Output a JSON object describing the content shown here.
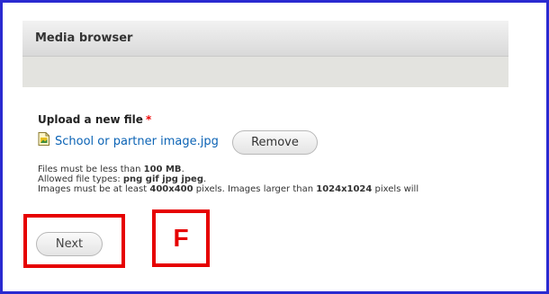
{
  "dialog": {
    "title": "Media browser"
  },
  "upload": {
    "label": "Upload a new file",
    "required_mark": "*",
    "file_name": "School or partner image.jpg",
    "file_icon": "image-file-icon",
    "remove_label": "Remove",
    "help_size_prefix": "Files must be less than ",
    "help_size_value": "100 MB",
    "help_size_suffix": ".",
    "help_types_prefix": "Allowed file types: ",
    "help_types_value": "png gif jpg jpeg",
    "help_types_suffix": ".",
    "help_dims_prefix": "Images must be at least ",
    "help_dims_min": "400x400",
    "help_dims_mid": " pixels. Images larger than ",
    "help_dims_max": "1024x1024",
    "help_dims_suffix": " pixels will"
  },
  "actions": {
    "next_label": "Next"
  },
  "annotation": {
    "marker_letter": "F",
    "color": "#e60000"
  },
  "colors": {
    "frame_border": "#2a2ad0",
    "link": "#0b63b5"
  }
}
